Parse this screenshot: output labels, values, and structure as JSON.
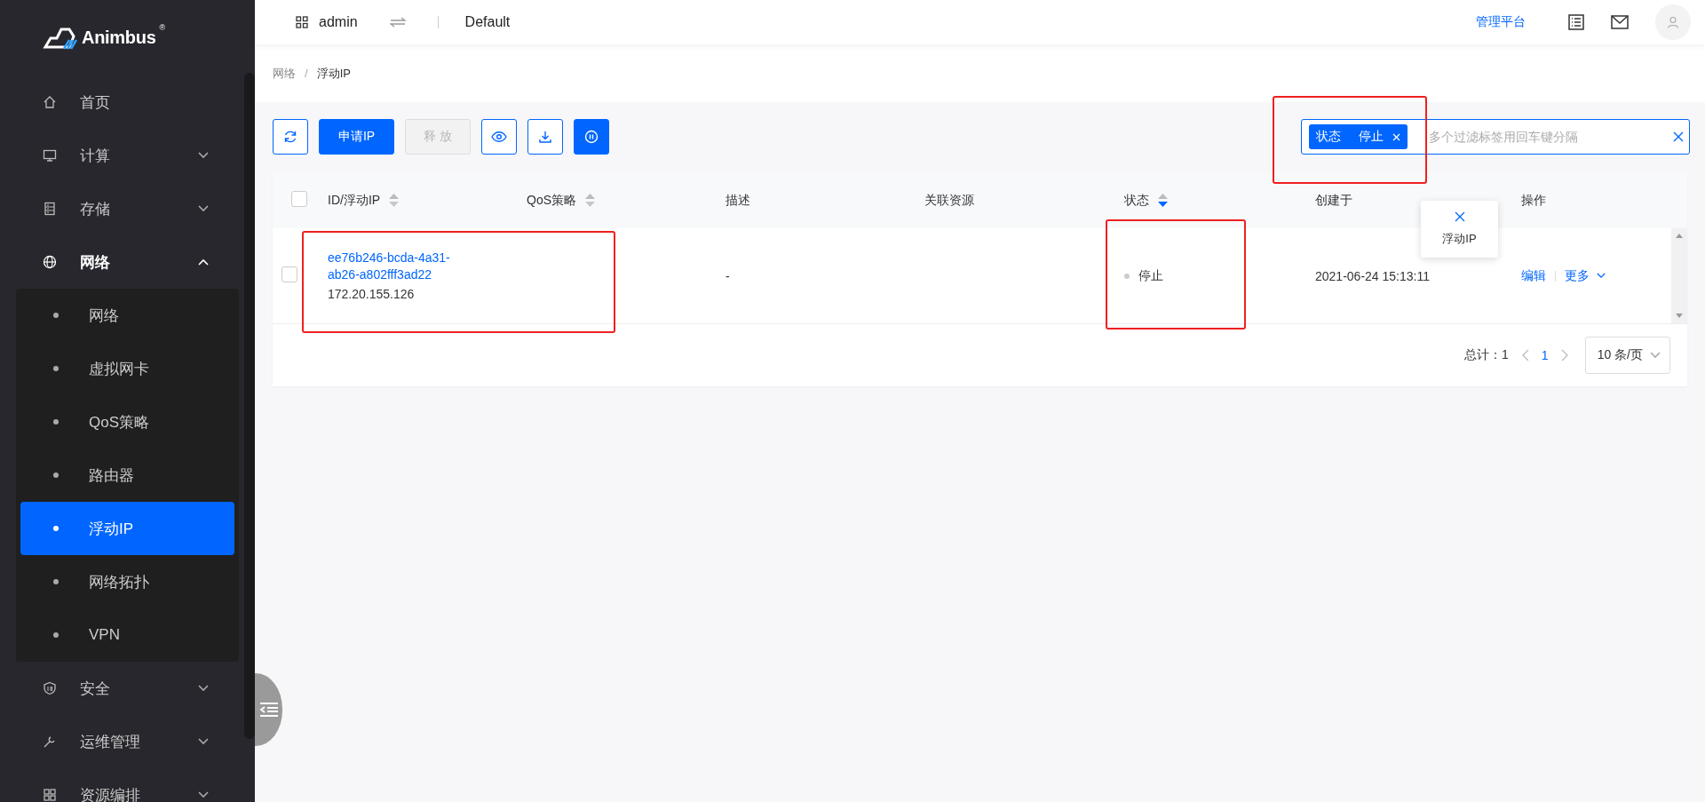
{
  "brand": {
    "name": "Animbus",
    "mark": "®"
  },
  "sidebar": {
    "items": [
      {
        "label": "首页",
        "kind": "link"
      },
      {
        "label": "计算",
        "kind": "group",
        "expanded": false
      },
      {
        "label": "存储",
        "kind": "group",
        "expanded": false
      },
      {
        "label": "网络",
        "kind": "group",
        "expanded": true,
        "children": [
          {
            "label": "网络",
            "selected": false
          },
          {
            "label": "虚拟网卡",
            "selected": false
          },
          {
            "label": "QoS策略",
            "selected": false
          },
          {
            "label": "路由器",
            "selected": false
          },
          {
            "label": "浮动IP",
            "selected": true
          },
          {
            "label": "网络拓扑",
            "selected": false
          },
          {
            "label": "VPN",
            "selected": false
          }
        ]
      },
      {
        "label": "安全",
        "kind": "group",
        "expanded": false
      },
      {
        "label": "运维管理",
        "kind": "group",
        "expanded": false
      },
      {
        "label": "资源编排",
        "kind": "group",
        "expanded": false
      }
    ]
  },
  "topbar": {
    "user": "admin",
    "project": "Default",
    "platform_link": "管理平台"
  },
  "breadcrumb": {
    "items": [
      "网络",
      "浮动IP"
    ],
    "separator": "/"
  },
  "toolbar": {
    "buttons": [
      {
        "kind": "refresh",
        "disabled": false
      },
      {
        "kind": "primary",
        "label": "申请IP",
        "disabled": false
      },
      {
        "kind": "text",
        "label": "释 放",
        "disabled": true
      },
      {
        "kind": "view",
        "disabled": false
      },
      {
        "kind": "download",
        "disabled": false
      },
      {
        "kind": "pause",
        "disabled": false
      }
    ]
  },
  "filter": {
    "tags": [
      {
        "key": "状态",
        "value": "停止"
      }
    ],
    "placeholder": "多个过滤标签用回车键分隔",
    "dropdown": {
      "items": [
        {
          "label": "浮动IP"
        }
      ]
    }
  },
  "table": {
    "select_all": {
      "checked": false
    },
    "columns": [
      {
        "label": "ID/浮动IP",
        "sortable": true,
        "sort_active": false
      },
      {
        "label": "QoS策略",
        "sortable": true,
        "sort_active": false
      },
      {
        "label": "描述",
        "sortable": false
      },
      {
        "label": "关联资源",
        "sortable": false
      },
      {
        "label": "状态",
        "sortable": true,
        "sort_active": true
      },
      {
        "label": "创建于",
        "sortable": false
      },
      {
        "label": "操作",
        "sortable": false
      }
    ],
    "rows": [
      {
        "checked": false,
        "id": "ee76b246-bcda-4a31-ab26-a802fff3ad22",
        "ip": "172.20.155.126",
        "description": "-",
        "status": "停止",
        "created": "2021-06-24 15:13:11",
        "actions": [
          "编辑",
          "更多"
        ]
      }
    ]
  },
  "pagination": {
    "total_label": "总计：",
    "total": "1",
    "page": "1",
    "page_size": "10 条/页"
  }
}
